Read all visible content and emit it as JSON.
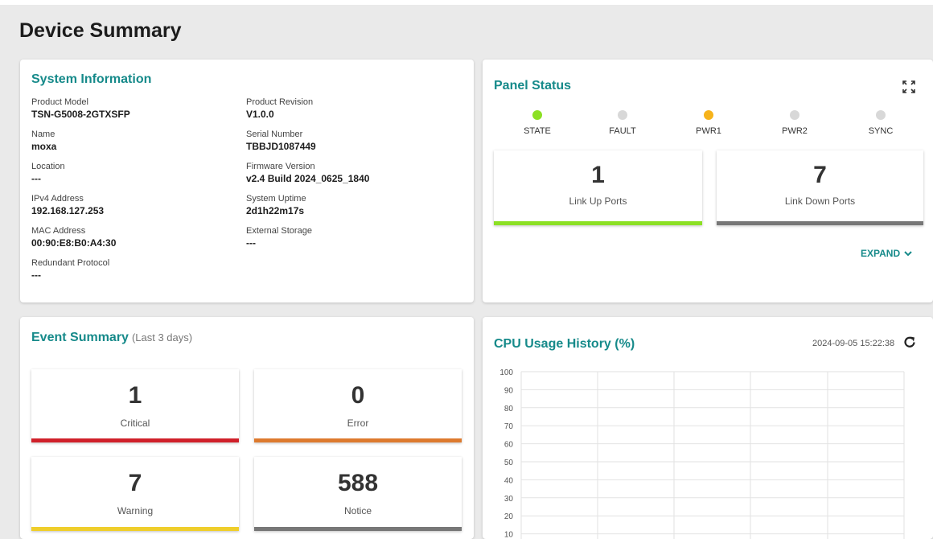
{
  "page": {
    "title": "Device Summary"
  },
  "system_info": {
    "title": "System Information",
    "left": [
      {
        "label": "Product Model",
        "value": "TSN-G5008-2GTXSFP"
      },
      {
        "label": "Name",
        "value": "moxa"
      },
      {
        "label": "Location",
        "value": "---"
      },
      {
        "label": "IPv4 Address",
        "value": "192.168.127.253"
      },
      {
        "label": "MAC Address",
        "value": "00:90:E8:B0:A4:30"
      },
      {
        "label": "Redundant Protocol",
        "value": "---"
      }
    ],
    "right": [
      {
        "label": "Product Revision",
        "value": "V1.0.0"
      },
      {
        "label": "Serial Number",
        "value": "TBBJD1087449"
      },
      {
        "label": "Firmware Version",
        "value": "v2.4 Build 2024_0625_1840"
      },
      {
        "label": "System Uptime",
        "value": "2d1h22m17s"
      },
      {
        "label": "External Storage",
        "value": "---"
      }
    ]
  },
  "panel_status": {
    "title": "Panel Status",
    "fullscreen_icon": "fullscreen-icon",
    "leds": [
      {
        "label": "STATE",
        "color": "#8ce024"
      },
      {
        "label": "FAULT",
        "color": "#d8d8d8"
      },
      {
        "label": "PWR1",
        "color": "#f6b31b"
      },
      {
        "label": "PWR2",
        "color": "#d8d8d8"
      },
      {
        "label": "SYNC",
        "color": "#d8d8d8"
      }
    ],
    "link_up": {
      "value": "1",
      "label": "Link Up Ports",
      "color": "#8ce024"
    },
    "link_down": {
      "value": "7",
      "label": "Link Down Ports",
      "color": "#777777"
    },
    "expand_label": "EXPAND",
    "expand_icon": "chevron-down-icon"
  },
  "event_summary": {
    "title": "Event Summary",
    "subtitle": "(Last 3 days)",
    "items": [
      {
        "value": "1",
        "label": "Critical",
        "color": "#d0202a"
      },
      {
        "value": "0",
        "label": "Error",
        "color": "#dd7a2e"
      },
      {
        "value": "7",
        "label": "Warning",
        "color": "#efce2b"
      },
      {
        "value": "588",
        "label": "Notice",
        "color": "#777777"
      }
    ]
  },
  "cpu_usage": {
    "title": "CPU Usage History (%)",
    "timestamp": "2024-09-05 15:22:38",
    "refresh_icon": "refresh-icon"
  },
  "chart_data": {
    "type": "line",
    "title": "CPU Usage History (%)",
    "y_ticks": [
      "100",
      "90",
      "80",
      "70",
      "60",
      "50",
      "40",
      "30",
      "20",
      "10"
    ],
    "ylim": [
      0,
      100
    ],
    "grid": true,
    "series": []
  }
}
